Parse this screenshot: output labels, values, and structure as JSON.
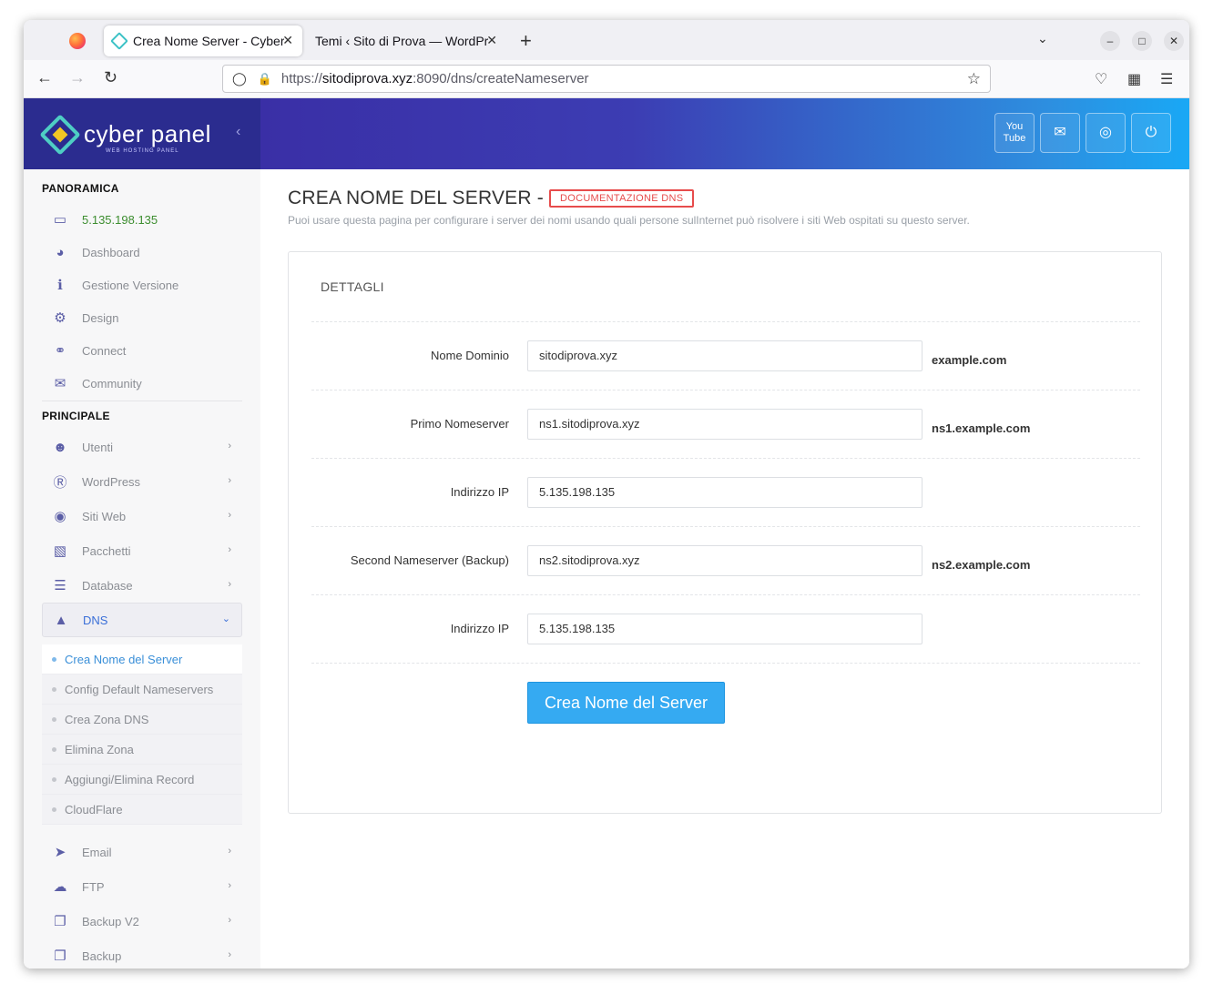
{
  "browser": {
    "tabs": [
      {
        "title": "Crea Nome Server - CyberPanel",
        "close": "✕"
      },
      {
        "title": "Temi ‹ Sito di Prova — WordPress",
        "close": "✕"
      }
    ],
    "new_tab": "+",
    "url_domain": "sitodiprova.xyz",
    "url_prefix": "https://",
    "url_suffix": ":8090/dns/createNameserver"
  },
  "app": {
    "logo_text": "cyber panel",
    "logo_sub": "WEB HOSTING PANEL"
  },
  "sidebar": {
    "section_overview": "PANORAMICA",
    "ip": "5.135.198.135",
    "overview_items": [
      {
        "label": "Dashboard",
        "icon": "gauge-icon"
      },
      {
        "label": "Gestione Versione",
        "icon": "info-icon"
      },
      {
        "label": "Design",
        "icon": "gear-icon"
      },
      {
        "label": "Connect",
        "icon": "link-icon"
      },
      {
        "label": "Community",
        "icon": "comments-icon"
      }
    ],
    "section_main": "PRINCIPALE",
    "main_items": [
      {
        "label": "Utenti",
        "icon": "users-icon"
      },
      {
        "label": "WordPress",
        "icon": "wordpress-icon"
      },
      {
        "label": "Siti Web",
        "icon": "globe-icon"
      },
      {
        "label": "Pacchetti",
        "icon": "cubes-icon"
      },
      {
        "label": "Database",
        "icon": "database-icon"
      }
    ],
    "dns_label": "DNS",
    "dns_submenu": [
      {
        "label": "Crea Nome del Server",
        "active": true
      },
      {
        "label": "Config Default Nameservers"
      },
      {
        "label": "Crea Zona DNS"
      },
      {
        "label": "Elimina Zona"
      },
      {
        "label": "Aggiungi/Elimina Record"
      },
      {
        "label": "CloudFlare"
      }
    ],
    "bottom_items": [
      {
        "label": "Email",
        "icon": "paper-plane-icon"
      },
      {
        "label": "FTP",
        "icon": "cloud-upload-icon"
      },
      {
        "label": "Backup V2",
        "icon": "copy-icon"
      },
      {
        "label": "Backup",
        "icon": "copy-icon"
      }
    ]
  },
  "header_buttons": [
    "youtube-icon",
    "chat-icon",
    "lifebuoy-icon",
    "power-icon"
  ],
  "main": {
    "title": "CREA NOME DEL SERVER -",
    "doc_badge": "DOCUMENTAZIONE DNS",
    "description": "Puoi usare questa pagina per configurare i server dei nomi usando quali persone sulInternet può risolvere i siti Web ospitati su questo server.",
    "card_title": "DETTAGLI",
    "fields": [
      {
        "label": "Nome Dominio",
        "value": "sitodiprova.xyz",
        "hint": "example.com"
      },
      {
        "label": "Primo Nomeserver",
        "value": "ns1.sitodiprova.xyz",
        "hint": "ns1.example.com"
      },
      {
        "label": "Indirizzo IP",
        "value": "5.135.198.135",
        "hint": ""
      },
      {
        "label": "Second Nameserver (Backup)",
        "value": "ns2.sitodiprova.xyz",
        "hint": "ns2.example.com"
      },
      {
        "label": "Indirizzo IP",
        "value": "5.135.198.135",
        "hint": ""
      }
    ],
    "submit_label": "Crea Nome del Server"
  },
  "colors": {
    "sidebar_brand": "#2b2c8f",
    "accent_blue": "#35aaf2",
    "badge_red": "#e74c4c",
    "ip_green": "#3c8d2f"
  }
}
